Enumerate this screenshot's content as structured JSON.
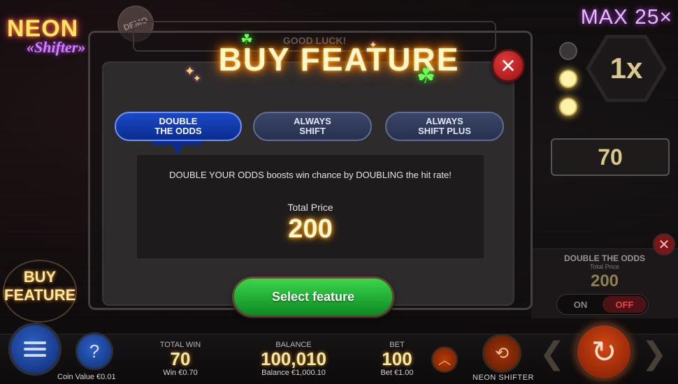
{
  "game": {
    "logo_line1": "NEON",
    "logo_line2": "«Shifter»",
    "demo_badge": "DEMO",
    "max_label": "MAX 25×",
    "multiplier": "1x",
    "side_counter": "70",
    "buy_feature_sign": "BUY FEATURE"
  },
  "modal": {
    "good_luck": "GOOD LUCK!",
    "title": "BUY FEATURE",
    "close_icon": "close-icon",
    "tabs": [
      {
        "label_line1": "DOUBLE",
        "label_line2": "THE ODDS",
        "active": true
      },
      {
        "label_line1": "ALWAYS",
        "label_line2": "SHIFT",
        "active": false
      },
      {
        "label_line1": "ALWAYS",
        "label_line2": "SHIFT PLUS",
        "active": false
      }
    ],
    "description": "DOUBLE YOUR ODDS boosts win chance by DOUBLING the hit rate!",
    "total_price_label": "Total Price",
    "total_price_value": "200",
    "select_button": "Select feature"
  },
  "side_panel": {
    "title": "DOUBLE THE ODDS",
    "subtitle": "Total Price",
    "price": "200",
    "toggle_on": "ON",
    "toggle_off": "OFF",
    "toggle_state": "OFF"
  },
  "bottom_bar": {
    "coin_value": "Coin Value €0.01",
    "total_win_label": "TOTAL WIN",
    "total_win_value": "70",
    "win_sub": "Win €0.70",
    "balance_label": "BALANCE",
    "balance_value": "100,010",
    "balance_sub": "Balance €1,000.10",
    "bet_label": "BET",
    "bet_value": "100",
    "bet_sub": "Bet €1.00",
    "game_name": "NEON SHIFTER",
    "help_label": "?"
  },
  "colors": {
    "title_glow": "#ff8c00",
    "active_tab": "#1b49c7",
    "select_button": "#1fa935",
    "close_button": "#c21e1e"
  }
}
